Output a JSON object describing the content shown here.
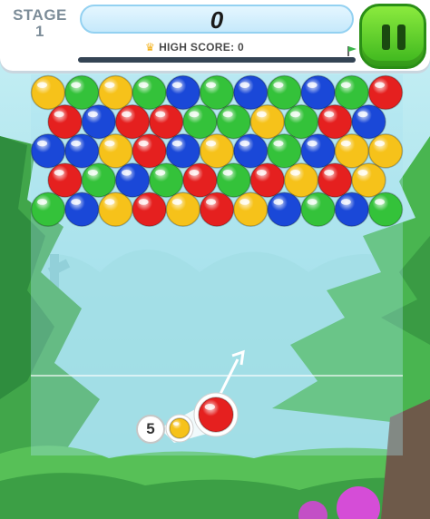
{
  "header": {
    "stage_label": "STAGE",
    "stage_number": "1",
    "score": "0",
    "high_score_text": "HIGH SCORE: 0",
    "progress_fraction": 0
  },
  "controls": {
    "pause_icon": "pause-icon",
    "remaining_bubbles": "5"
  },
  "colors": {
    "yellow": "#f6c21a",
    "green": "#34c23a",
    "blue": "#1a48d8",
    "red": "#e5201f",
    "pause_green": "#4cc423",
    "score_frame": "#93d1f1"
  },
  "board": {
    "rows": [
      [
        "yellow",
        "green",
        "yellow",
        "green",
        "blue",
        "green",
        "blue",
        "green",
        "blue",
        "green",
        "red"
      ],
      [
        "red",
        "blue",
        "red",
        "red",
        "green",
        "green",
        "yellow",
        "green",
        "red",
        "blue"
      ],
      [
        "blue",
        "blue",
        "yellow",
        "red",
        "blue",
        "yellow",
        "blue",
        "green",
        "blue",
        "yellow",
        "yellow"
      ],
      [
        "red",
        "green",
        "blue",
        "green",
        "red",
        "green",
        "red",
        "yellow",
        "red",
        "yellow"
      ],
      [
        "green",
        "blue",
        "yellow",
        "red",
        "yellow",
        "red",
        "yellow",
        "blue",
        "green",
        "blue",
        "green"
      ]
    ],
    "shooter_current": "red",
    "shooter_next": "yellow"
  }
}
